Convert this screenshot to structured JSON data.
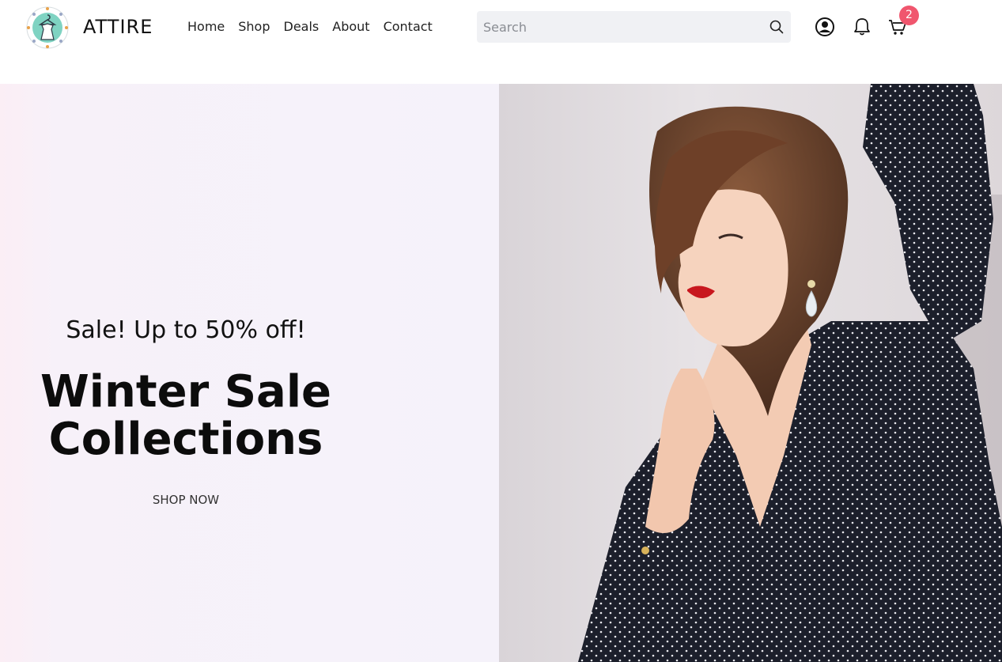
{
  "header": {
    "brand": "ATTIRE",
    "nav": [
      "Home",
      "Shop",
      "Deals",
      "About",
      "Contact"
    ],
    "search_placeholder": "Search",
    "cart_count": "2"
  },
  "icons": {
    "logo": "hanger-dress-logo",
    "search": "search-icon",
    "account": "user-circle-icon",
    "notifications": "bell-icon",
    "cart": "cart-icon"
  },
  "colors": {
    "badge": "#f0566e",
    "hero_left_bg": "#f5f2fa",
    "search_bg": "#f0f1f4"
  },
  "hero": {
    "subtitle": "Sale! Up to 50% off!",
    "title_line1": "Winter Sale",
    "title_line2": "Collections",
    "cta": "SHOP NOW"
  }
}
